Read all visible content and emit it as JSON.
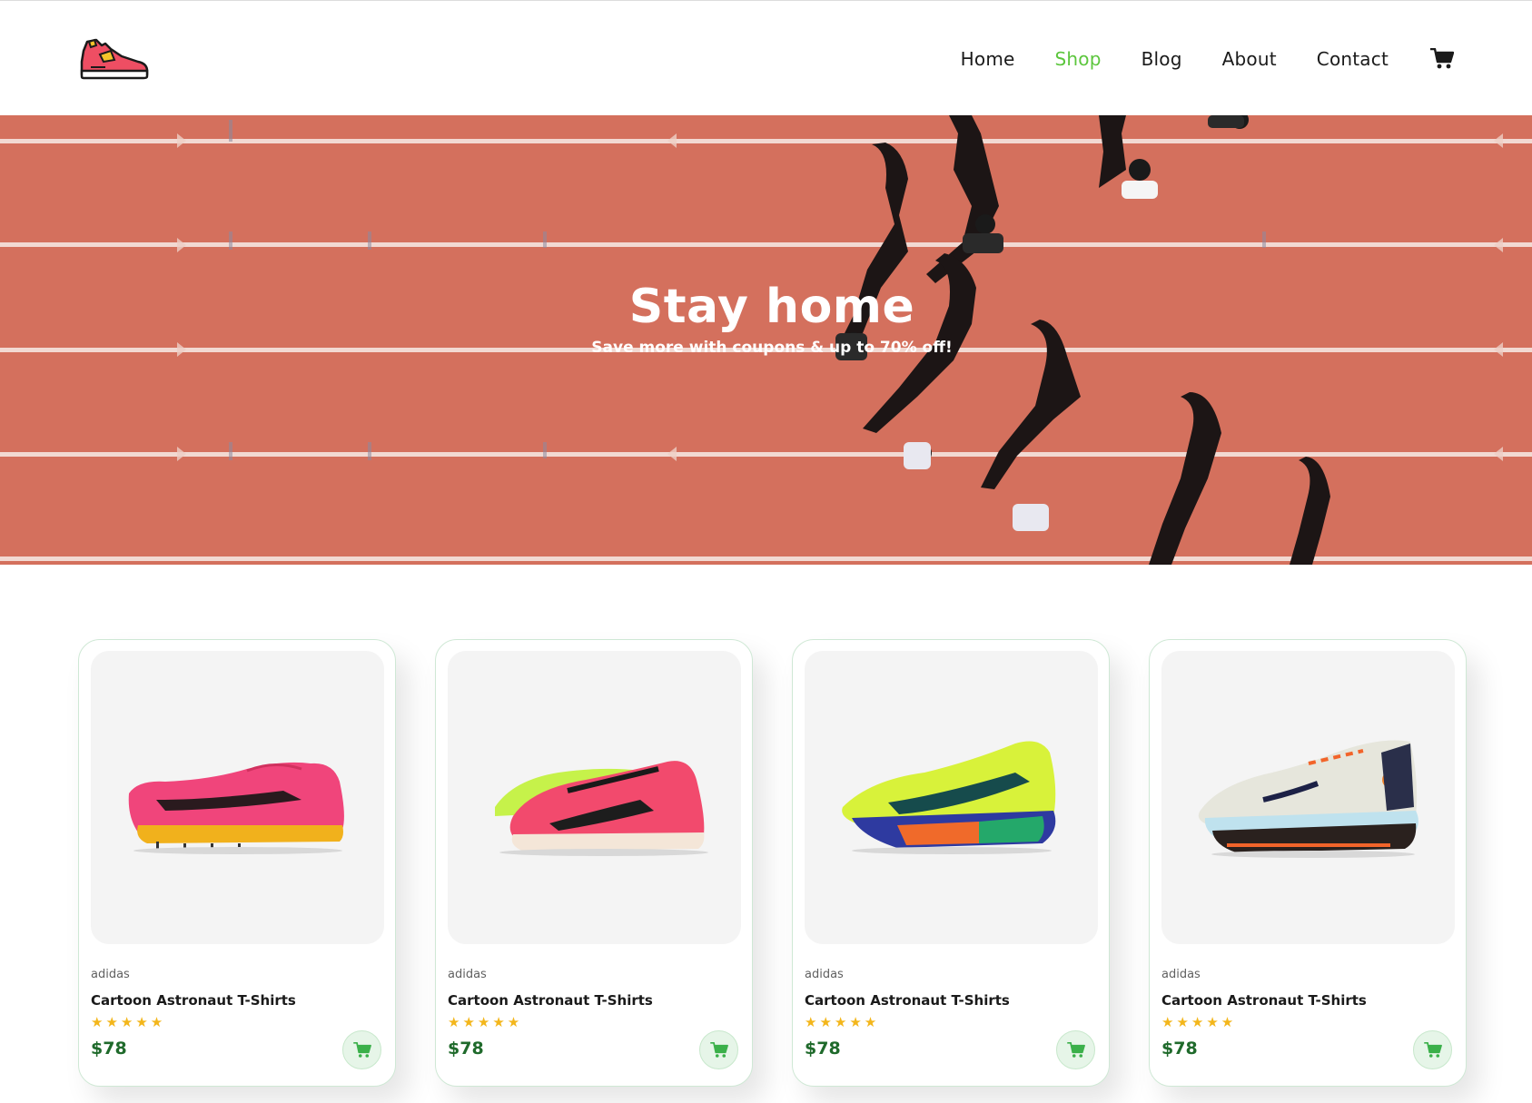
{
  "header": {
    "logo_icon": "sneaker-logo-icon",
    "nav": [
      {
        "label": "Home",
        "active": false
      },
      {
        "label": "Shop",
        "active": true
      },
      {
        "label": "Blog",
        "active": false
      },
      {
        "label": "About",
        "active": false
      },
      {
        "label": "Contact",
        "active": false
      }
    ],
    "cart_icon": "shopping-cart-icon"
  },
  "hero": {
    "title": "Stay home",
    "subtitle": "Save more with coupons & up to 70% off!"
  },
  "colors": {
    "accent": "#5cc63d",
    "price": "#1f6a2b",
    "star": "#f3b61b",
    "track": "#d4705d"
  },
  "products": [
    {
      "brand": "adidas",
      "name": "Cartoon Astronaut T-Shirts",
      "rating": 5,
      "stars": "★★★★★",
      "price": "$78",
      "image": "pink-spike-shoe"
    },
    {
      "brand": "adidas",
      "name": "Cartoon Astronaut T-Shirts",
      "rating": 5,
      "stars": "★★★★★",
      "price": "$78",
      "image": "pink-racing-shoe"
    },
    {
      "brand": "adidas",
      "name": "Cartoon Astronaut T-Shirts",
      "rating": 5,
      "stars": "★★★★★",
      "price": "$78",
      "image": "volt-running-shoe"
    },
    {
      "brand": "adidas",
      "name": "Cartoon Astronaut T-Shirts",
      "rating": 5,
      "stars": "★★★★★",
      "price": "$78",
      "image": "white-trail-shoe"
    }
  ]
}
